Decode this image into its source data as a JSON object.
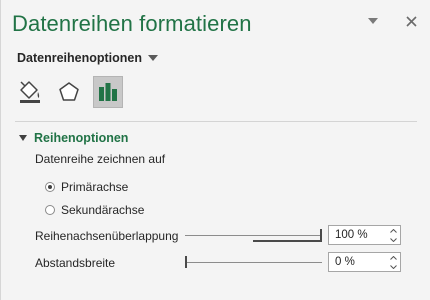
{
  "pane": {
    "title": "Datenreihen formatieren",
    "section_selector": "Datenreihenoptionen"
  },
  "icons": {
    "dropdown": "chevron-down-icon",
    "close": "close-icon",
    "fill_line": "paint-bucket-icon",
    "effects": "pentagon-icon",
    "series_options": "bar-chart-icon",
    "collapse": "triangle-down-icon"
  },
  "group": {
    "label": "Reihenoptionen",
    "plot_on_label": "Datenreihe zeichnen auf",
    "radios": [
      {
        "label": "Primärachse",
        "checked": true
      },
      {
        "label": "Sekundärachse",
        "checked": false
      }
    ],
    "overlap": {
      "label": "Reihenachsenüberlappung",
      "value": "100 %",
      "fraction": 1.0
    },
    "gap_width": {
      "label": "Abstandsbreite",
      "value": "0 %",
      "fraction": 0.0
    }
  },
  "colors": {
    "accent": "#217346",
    "selected_tab_bg": "#c8c8c8",
    "pane_bg": "#f4f4f4"
  }
}
